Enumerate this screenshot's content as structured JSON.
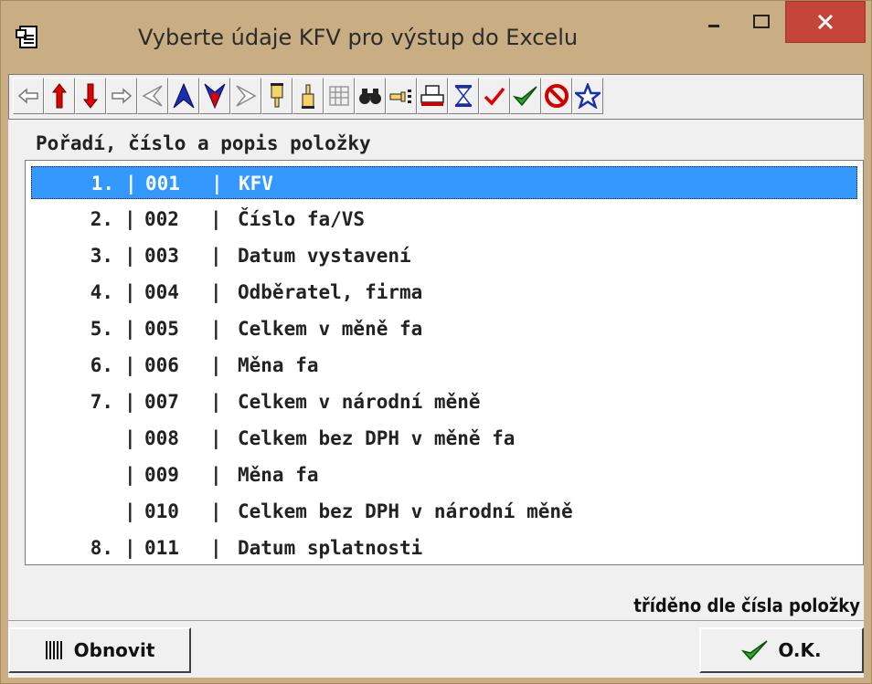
{
  "window": {
    "title": "Vyberte údaje KFV pro výstup do Excelu",
    "controls": {
      "minimize_icon": "minimize-icon",
      "maximize_icon": "maximize-icon",
      "close_icon": "close-icon"
    }
  },
  "toolbar": {
    "buttons": [
      {
        "name": "first-arrow-icon"
      },
      {
        "name": "up-arrow-icon"
      },
      {
        "name": "down-arrow-icon"
      },
      {
        "name": "last-arrow-icon"
      },
      {
        "name": "page-left-icon"
      },
      {
        "name": "page-up-icon"
      },
      {
        "name": "page-down-icon"
      },
      {
        "name": "page-right-icon"
      },
      {
        "name": "hand-point-down-icon"
      },
      {
        "name": "hand-point-up-icon"
      },
      {
        "name": "grid-disabled-icon"
      },
      {
        "name": "binoculars-icon"
      },
      {
        "name": "hand-point-list-icon"
      },
      {
        "name": "printer-icon"
      },
      {
        "name": "hourglass-icon"
      },
      {
        "name": "checkmark-red-icon"
      },
      {
        "name": "checkmark-green-icon"
      },
      {
        "name": "forbidden-icon"
      },
      {
        "name": "star-icon"
      }
    ]
  },
  "list": {
    "header": "Pořadí, číslo a popis položky",
    "rows": [
      {
        "no": "1.",
        "sep": "|",
        "code": "001",
        "desc": "KFV",
        "selected": true
      },
      {
        "no": "2.",
        "sep": "|",
        "code": "002",
        "desc": "Číslo fa/VS"
      },
      {
        "no": "3.",
        "sep": "|",
        "code": "003",
        "desc": "Datum vystavení"
      },
      {
        "no": "4.",
        "sep": "|",
        "code": "004",
        "desc": "Odběratel, firma"
      },
      {
        "no": "5.",
        "sep": "|",
        "code": "005",
        "desc": "Celkem v měně fa"
      },
      {
        "no": "6.",
        "sep": "|",
        "code": "006",
        "desc": "Měna fa"
      },
      {
        "no": "7.",
        "sep": "|",
        "code": "007",
        "desc": "Celkem v národní měně"
      },
      {
        "no": "",
        "sep": "|",
        "code": "008",
        "desc": "Celkem bez DPH v měně fa"
      },
      {
        "no": "",
        "sep": "|",
        "code": "009",
        "desc": "Měna fa"
      },
      {
        "no": "",
        "sep": "|",
        "code": "010",
        "desc": "Celkem bez DPH v národní měně"
      },
      {
        "no": "8.",
        "sep": "|",
        "code": "011",
        "desc": "Datum splatnosti"
      }
    ]
  },
  "status": {
    "sort": "tříděno dle čísla položky"
  },
  "buttons": {
    "refresh": "Obnovit",
    "ok": "O.K."
  },
  "colors": {
    "titlebar": "#c9ae84",
    "selection": "#3399ff",
    "close": "#c5443a"
  }
}
